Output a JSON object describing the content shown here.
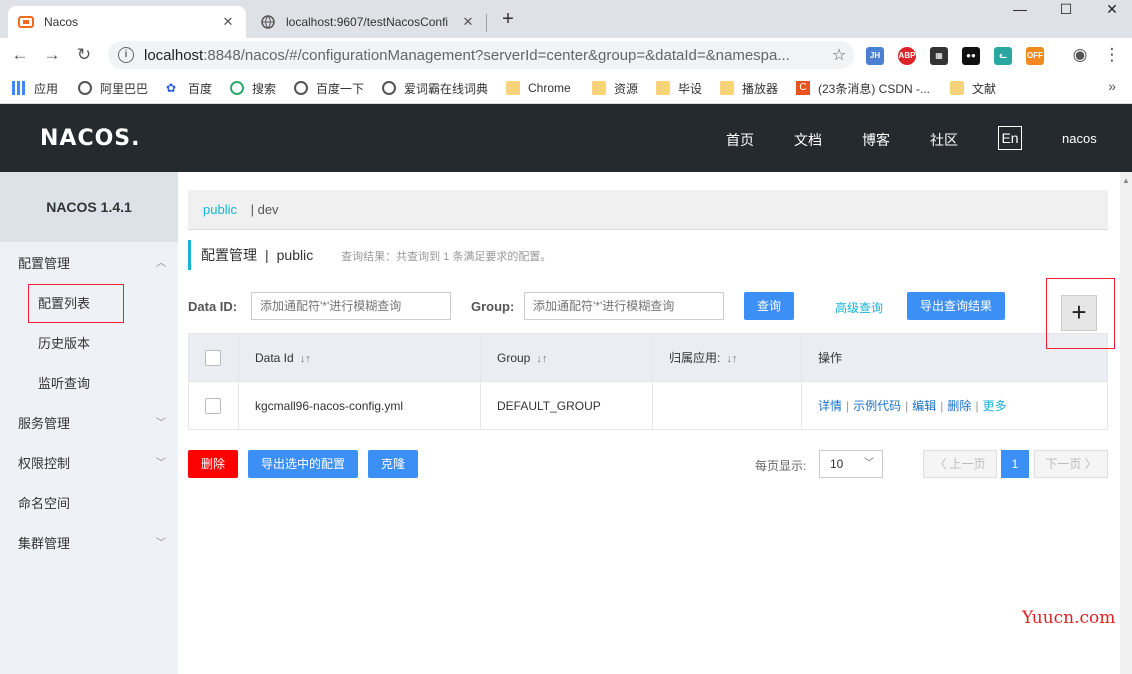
{
  "browser": {
    "tabs": [
      {
        "label": "Nacos",
        "active": true,
        "close": "✕"
      },
      {
        "label": "localhost:9607/testNacosConfi",
        "active": false,
        "close": "✕"
      }
    ],
    "new_tab": "+",
    "window_controls": {
      "minimize": "—",
      "maximize": "☐",
      "close": "✕"
    },
    "url_host": "localhost",
    "url_rest": ":8848/nacos/#/configurationManagement?serverId=center&group=&dataId=&namespa...",
    "extensions": [
      {
        "name": "jh-icon",
        "label": "JH",
        "color": "#4a7fd4"
      },
      {
        "name": "abp-icon",
        "label": "ABP",
        "color": "#d9252a"
      },
      {
        "name": "qr-icon",
        "label": "▦",
        "color": "#333333"
      },
      {
        "name": "tampermonkey-icon",
        "label": "●●",
        "color": "#111111"
      },
      {
        "name": "cat-icon",
        "label": "ᓚ",
        "color": "#2aa7a0"
      },
      {
        "name": "off-icon",
        "label": "OFF",
        "color": "#f08a1c"
      }
    ],
    "bookmarks": [
      {
        "label": "应用",
        "icon": "apps"
      },
      {
        "label": "阿里巴巴",
        "icon": "globe"
      },
      {
        "label": "百度",
        "icon": "paw"
      },
      {
        "label": "搜索",
        "icon": "circle"
      },
      {
        "label": "百度一下",
        "icon": "globe"
      },
      {
        "label": "爱词霸在线词典",
        "icon": "globe"
      },
      {
        "label": "Chrome",
        "icon": "folder"
      },
      {
        "label": "资源",
        "icon": "folder"
      },
      {
        "label": "毕设",
        "icon": "folder"
      },
      {
        "label": "播放器",
        "icon": "folder"
      },
      {
        "label": "(23条消息) CSDN -...",
        "icon": "csdn"
      },
      {
        "label": "文献",
        "icon": "folder"
      }
    ],
    "bookmarks_more": "»"
  },
  "header": {
    "logo": "NACOS.",
    "nav": [
      "首页",
      "文档",
      "博客",
      "社区"
    ],
    "lang": "En",
    "user": "nacos"
  },
  "sidebar": {
    "title": "NACOS 1.4.1",
    "items": [
      {
        "label": "配置管理",
        "expanded": true
      },
      {
        "label": "配置列表",
        "sub": true,
        "selected": true
      },
      {
        "label": "历史版本",
        "sub": true
      },
      {
        "label": "监听查询",
        "sub": true
      },
      {
        "label": "服务管理",
        "expanded": false
      },
      {
        "label": "权限控制",
        "expanded": false
      },
      {
        "label": "命名空间"
      },
      {
        "label": "集群管理",
        "expanded": false
      }
    ]
  },
  "namespaces": {
    "active": "public",
    "other": "| dev"
  },
  "page": {
    "title": "配置管理",
    "separator": "|",
    "namespace": "public",
    "result": "查询结果：共查询到 1 条满足要求的配置。"
  },
  "filters": {
    "data_id_label": "Data ID:",
    "data_id_placeholder": "添加通配符'*'进行模糊查询",
    "group_label": "Group:",
    "group_placeholder": "添加通配符'*'进行模糊查询",
    "query_button": "查询",
    "advanced_query": "高级查询",
    "export_button": "导出查询结果",
    "add_button": "+"
  },
  "table": {
    "columns": [
      "Data Id",
      "Group",
      "归属应用:",
      "操作"
    ],
    "rows": [
      {
        "data_id": "kgcmall96-nacos-config.yml",
        "group": "DEFAULT_GROUP",
        "app": "",
        "ops": [
          "详情",
          "示例代码",
          "编辑",
          "删除",
          "更多"
        ]
      }
    ]
  },
  "bulk": {
    "delete": "删除",
    "export_selected": "导出选中的配置",
    "clone": "克隆"
  },
  "pagination": {
    "per_page_label": "每页显示:",
    "per_page": "10",
    "prev": "〈 上一页",
    "current": "1",
    "next": "下一页 〉"
  },
  "watermark": "Yuucn.com",
  "colors": {
    "accent": "#1ab2d5",
    "primary": "#3c8ff5",
    "danger": "#ff0000",
    "header_bg": "#252a2f"
  }
}
